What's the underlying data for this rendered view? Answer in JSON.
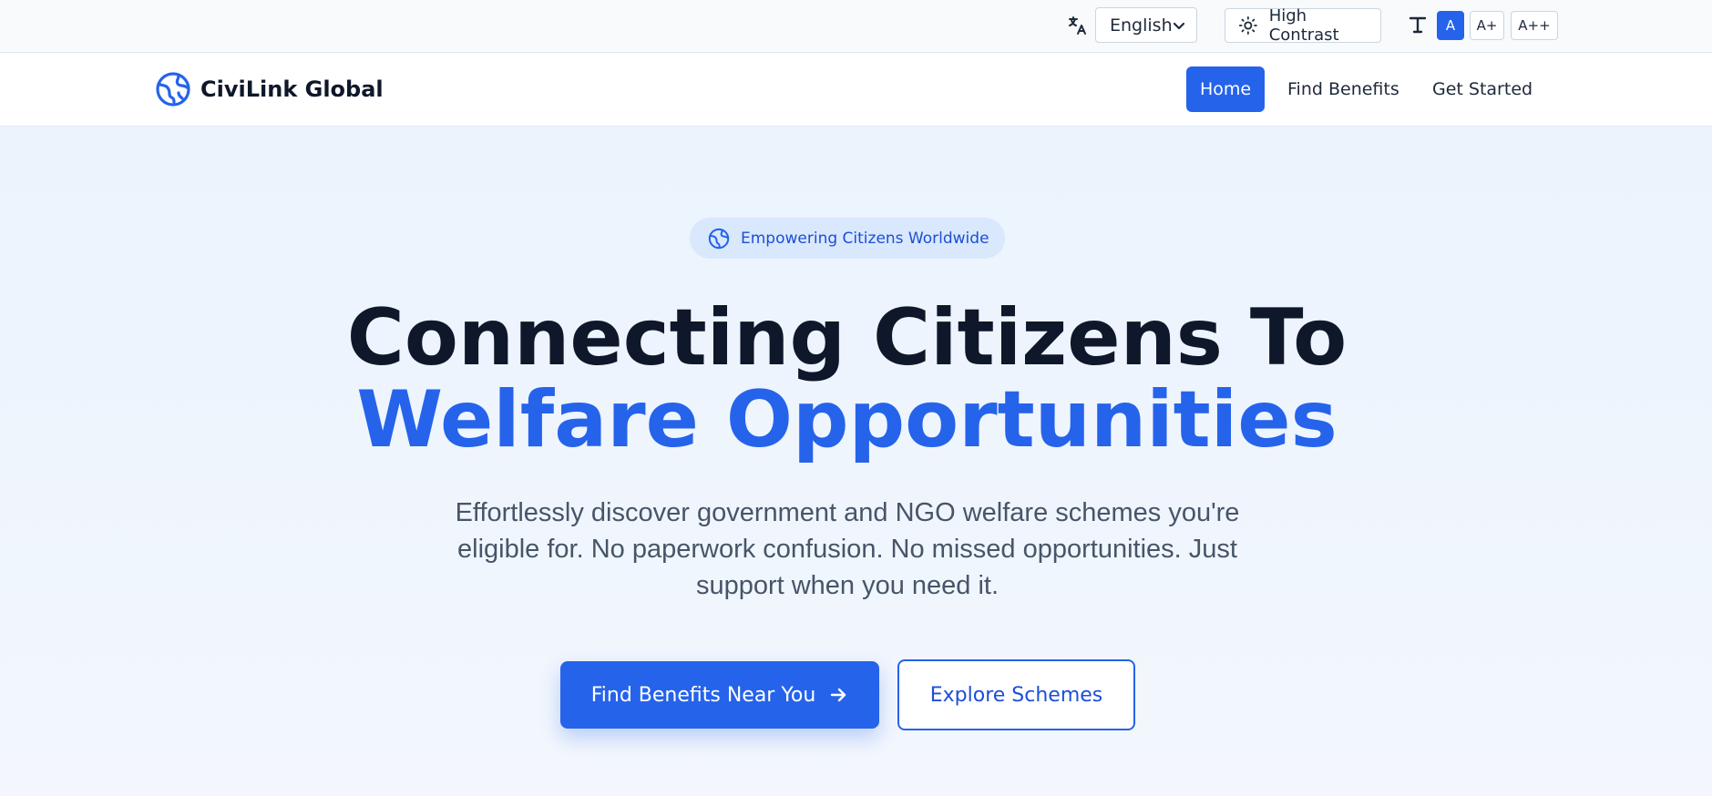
{
  "utility_bar": {
    "language": {
      "selected": "English"
    },
    "high_contrast_label": "High Contrast",
    "text_sizes": [
      "A",
      "A+",
      "A++"
    ],
    "active_text_size": "A"
  },
  "navbar": {
    "brand": "CiviLink Global",
    "links": [
      {
        "label": "Home",
        "active": true
      },
      {
        "label": "Find Benefits",
        "active": false
      },
      {
        "label": "Get Started",
        "active": false
      }
    ]
  },
  "hero": {
    "badge": "Empowering Citizens Worldwide",
    "headline_line1": "Connecting Citizens To",
    "headline_line2": "Welfare Opportunities",
    "description": "Effortlessly discover government and NGO welfare schemes you're eligible for. No paperwork confusion. No missed opportunities. Just support when you need it.",
    "primary_cta": "Find Benefits Near You",
    "secondary_cta": "Explore Schemes"
  },
  "colors": {
    "accent": "#2563eb",
    "heading": "#0f172a",
    "body_text": "#475569",
    "hero_background": "#eef4fd"
  },
  "icons": {
    "language": "translate-icon",
    "contrast": "sun-icon",
    "text_size": "text-size-icon",
    "brand": "globe-logo-icon",
    "badge": "globe-icon",
    "cta_arrow": "arrow-right-icon",
    "select_chevron": "chevron-down-icon"
  }
}
